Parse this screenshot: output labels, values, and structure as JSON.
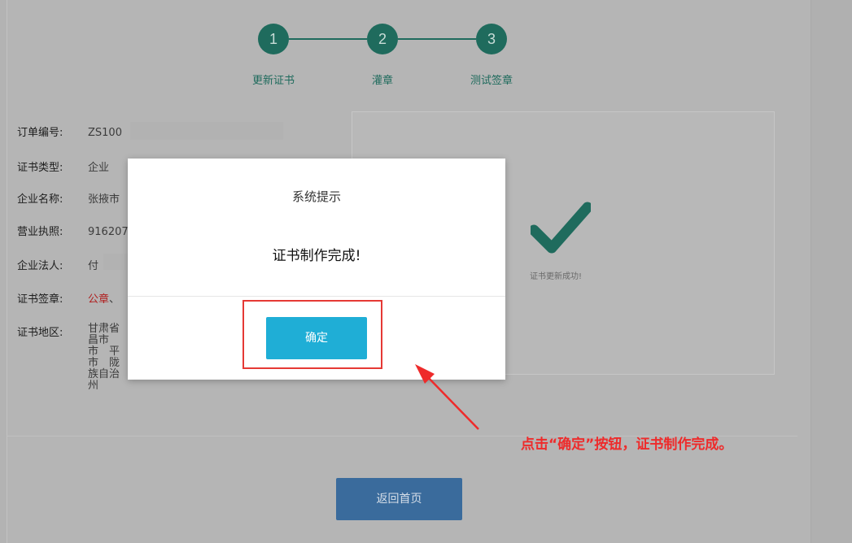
{
  "steps": [
    {
      "number": "1",
      "label": "更新证书"
    },
    {
      "number": "2",
      "label": "灌章"
    },
    {
      "number": "3",
      "label": "测试签章"
    }
  ],
  "info": {
    "order_no": {
      "label": "订单编号:",
      "value": "ZS100"
    },
    "cert_type": {
      "label": "证书类型:",
      "value": "企业"
    },
    "company_name": {
      "label": "企业名称:",
      "value": "张掖市"
    },
    "license": {
      "label": "营业执照:",
      "value": "916207"
    },
    "legal_person": {
      "label": "企业法人:",
      "value": "付"
    },
    "cert_seal": {
      "label": "证书签章:",
      "value": "公章",
      "suffix": "、"
    },
    "cert_region": {
      "label": "证书地区:",
      "lines": [
        "甘肃省",
        "昌市",
        "市　平",
        "市　陇",
        "族自治州"
      ]
    }
  },
  "result": {
    "success_text": "证书更新成功!"
  },
  "dialog": {
    "title": "系统提示",
    "message": "证书制作完成!",
    "ok_label": "确定"
  },
  "footer": {
    "home_button": "返回首页"
  },
  "annotation": {
    "text": "点击“确定”按钮，证书制作完成。"
  },
  "colors": {
    "step_green": "#1f6b5d",
    "ok_button": "#1faed6",
    "highlight_red": "#e53935",
    "home_button": "#3a6b9c"
  }
}
